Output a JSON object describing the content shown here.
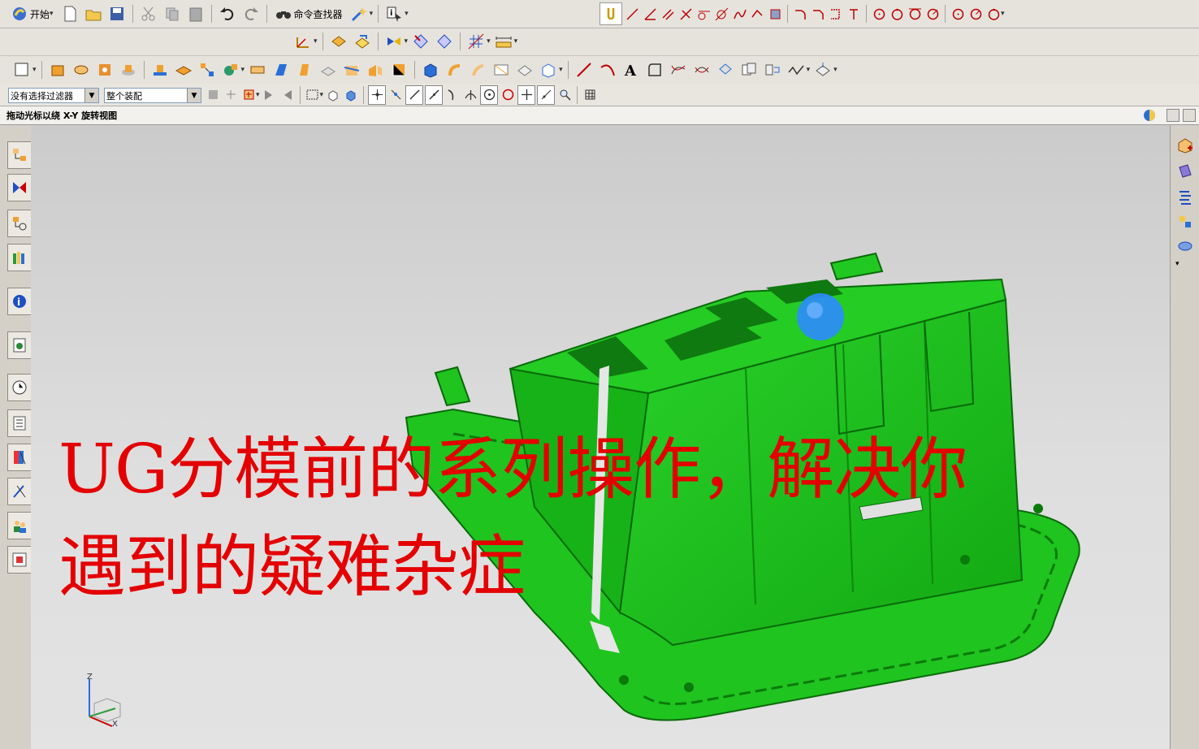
{
  "toolbar": {
    "start_label": "开始",
    "command_finder_label": "命令查找器",
    "filter_select": "没有选择过滤器",
    "assembly_select": "整个装配"
  },
  "cue_line": {
    "text": "拖动光标以绕 X-Y 旋转视图"
  },
  "overlay": {
    "line1": "UG分模前的系列操作，解决你",
    "line2": "遇到的疑难杂症",
    "color": "#e40000"
  },
  "model": {
    "color": "#1fc41f",
    "highlight_color": "#2e8cff"
  },
  "triad": {
    "z": "Z",
    "x": "X"
  }
}
